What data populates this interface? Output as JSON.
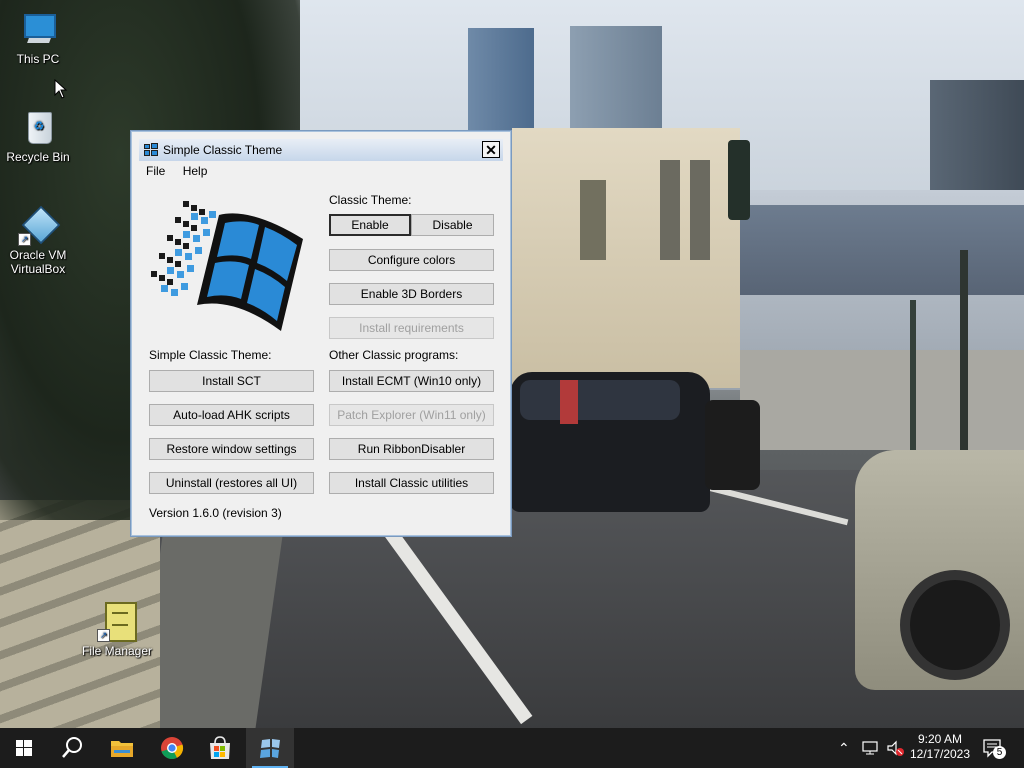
{
  "desktop": {
    "icons": [
      {
        "label": "This PC"
      },
      {
        "label": "Recycle Bin"
      },
      {
        "label": "Oracle VM VirtualBox"
      },
      {
        "label": "File Manager"
      }
    ]
  },
  "window": {
    "title": "Simple Classic Theme",
    "close_glyph": "✕",
    "menu": [
      "File",
      "Help"
    ],
    "classic_theme_label": "Classic Theme:",
    "enable_label": "Enable",
    "disable_label": "Disable",
    "configure_colors_label": "Configure colors",
    "enable_3d_borders_label": "Enable 3D Borders",
    "install_requirements_label": "Install requirements",
    "sct_section_label": "Simple Classic Theme:",
    "other_programs_label": "Other Classic programs:",
    "install_sct_label": "Install SCT",
    "install_ecmt_label": "Install ECMT (Win10 only)",
    "autoload_ahk_label": "Auto-load AHK scripts",
    "patch_explorer_label": "Patch Explorer (Win11 only)",
    "restore_window_label": "Restore window settings",
    "run_ribbon_label": "Run RibbonDisabler",
    "uninstall_label": "Uninstall (restores all UI)",
    "install_utilities_label": "Install Classic utilities",
    "version": "Version 1.6.0 (revision 3)"
  },
  "taskbar": {
    "pinned": [
      "start-icon",
      "search-icon",
      "file-explorer-icon",
      "chrome-icon",
      "store-icon",
      "simple-classic-theme-icon"
    ],
    "time": "9:20 AM",
    "date": "12/17/2023",
    "notification_count": "5",
    "accent": "#5fb2f2"
  }
}
